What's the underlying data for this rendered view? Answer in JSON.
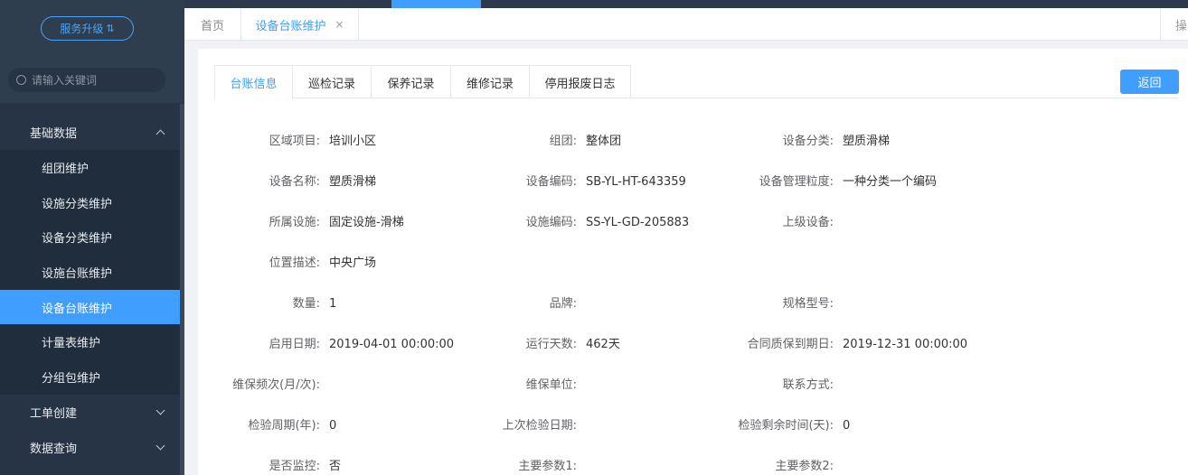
{
  "sidebar": {
    "upgrade_label": "服务升级",
    "search_placeholder": "请输入关键词",
    "groups": [
      {
        "label": "基础数据",
        "expanded": true
      },
      {
        "label": "工单创建",
        "expanded": false
      },
      {
        "label": "数据查询",
        "expanded": false
      }
    ],
    "items": [
      {
        "label": "组团维护"
      },
      {
        "label": "设施分类维护"
      },
      {
        "label": "设备分类维护"
      },
      {
        "label": "设施台账维护"
      },
      {
        "label": "设备台账维护",
        "active": true
      },
      {
        "label": "计量表维护"
      },
      {
        "label": "分组包维护"
      }
    ]
  },
  "tabs": {
    "home": "首页",
    "current": "设备台账维护",
    "close": "×",
    "right_partial": "操"
  },
  "detail": {
    "tabs": [
      "台账信息",
      "巡检记录",
      "保养记录",
      "维修记录",
      "停用报废日志"
    ],
    "active_tab": "台账信息",
    "back_label": "返回",
    "rows": [
      [
        {
          "label": "区域项目:",
          "value": "培训小区"
        },
        {
          "label": "组团:",
          "value": "整体团"
        },
        {
          "label": "设备分类:",
          "value": "塑质滑梯"
        }
      ],
      [
        {
          "label": "设备名称:",
          "value": "塑质滑梯"
        },
        {
          "label": "设备编码:",
          "value": "SB-YL-HT-643359"
        },
        {
          "label": "设备管理粒度:",
          "value": "一种分类一个编码"
        }
      ],
      [
        {
          "label": "所属设施:",
          "value": "固定设施-滑梯"
        },
        {
          "label": "设施编码:",
          "value": "SS-YL-GD-205883"
        },
        {
          "label": "上级设备:",
          "value": ""
        }
      ],
      [
        {
          "label": "位置描述:",
          "value": "中央广场"
        }
      ],
      [
        {
          "label": "数量:",
          "value": "1"
        },
        {
          "label": "品牌:",
          "value": ""
        },
        {
          "label": "规格型号:",
          "value": ""
        }
      ],
      [
        {
          "label": "启用日期:",
          "value": "2019-04-01 00:00:00"
        },
        {
          "label": "运行天数:",
          "value": "462天"
        },
        {
          "label": "合同质保到期日:",
          "value": "2019-12-31 00:00:00"
        }
      ],
      [
        {
          "label": "维保频次(月/次):",
          "value": ""
        },
        {
          "label": "维保单位:",
          "value": ""
        },
        {
          "label": "联系方式:",
          "value": ""
        }
      ],
      [
        {
          "label": "检验周期(年):",
          "value": "0"
        },
        {
          "label": "上次检验日期:",
          "value": ""
        },
        {
          "label": "检验剩余时间(天):",
          "value": "0"
        }
      ],
      [
        {
          "label": "是否监控:",
          "value": "否"
        },
        {
          "label": "主要参数1:",
          "value": ""
        },
        {
          "label": "主要参数2:",
          "value": ""
        }
      ]
    ]
  }
}
